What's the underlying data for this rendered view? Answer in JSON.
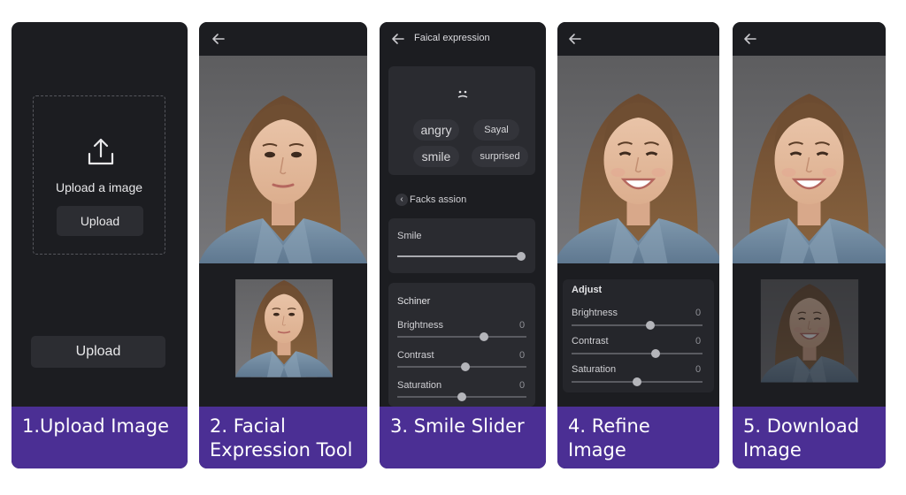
{
  "steps": [
    {
      "caption": "1.Upload Image"
    },
    {
      "caption": "2. Facial\nExpression Tool"
    },
    {
      "caption": "3. Smile Slider"
    },
    {
      "caption": "4. Refine Image"
    },
    {
      "caption": "5. Download\nImage"
    }
  ],
  "upload": {
    "prompt": "Upload a image",
    "inner_button": "Upload",
    "bottom_button": "Upload"
  },
  "expression": {
    "title": "Faical expression",
    "chips": [
      "angry",
      "Sayal",
      "smile",
      "surprised"
    ],
    "section_row": "Facks assion",
    "smile_label": "Smile",
    "smile_value": 1.0,
    "adjust_title": "Schiner",
    "adjust": [
      {
        "label": "Brightness",
        "value": "0",
        "level": 0.67
      },
      {
        "label": "Contrast",
        "value": "0",
        "level": 0.53
      },
      {
        "label": "Saturation",
        "value": "0",
        "level": 0.5
      }
    ]
  },
  "refine": {
    "title": "Adjust",
    "adjust": [
      {
        "label": "Brightness",
        "value": "0",
        "level": 0.6
      },
      {
        "label": "Contrast",
        "value": "0",
        "level": 0.64
      },
      {
        "label": "Saturation",
        "value": "0",
        "level": 0.5
      }
    ]
  },
  "colors": {
    "panel_bg": "#1c1d21",
    "caption_bg": "#4b2f94",
    "card_bg": "#2a2b30"
  },
  "icons": [
    "back-arrow-icon",
    "upload-icon",
    "chevron-left-icon",
    "face-icon"
  ]
}
